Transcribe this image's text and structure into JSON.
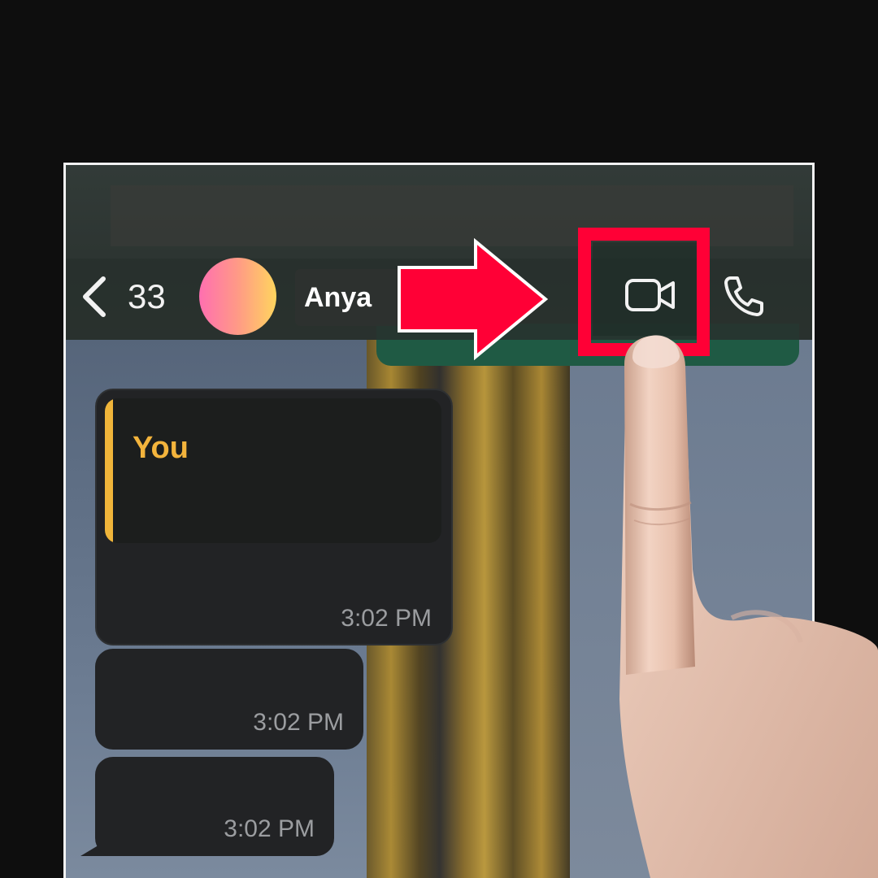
{
  "header": {
    "back_count": "33",
    "contact_name": "Anya",
    "icons": [
      "chevron-left-icon",
      "video-camera-icon",
      "phone-icon"
    ]
  },
  "messages": [
    {
      "quote_author": "You",
      "time": "3:02 PM"
    },
    {
      "time": "3:02 PM"
    },
    {
      "time": "3:02 PM"
    }
  ],
  "colors": {
    "highlight": "#ff0036",
    "quote_accent": "#f0b53a",
    "avatar_start": "#ff6fb0",
    "avatar_end": "#ffd55e"
  }
}
